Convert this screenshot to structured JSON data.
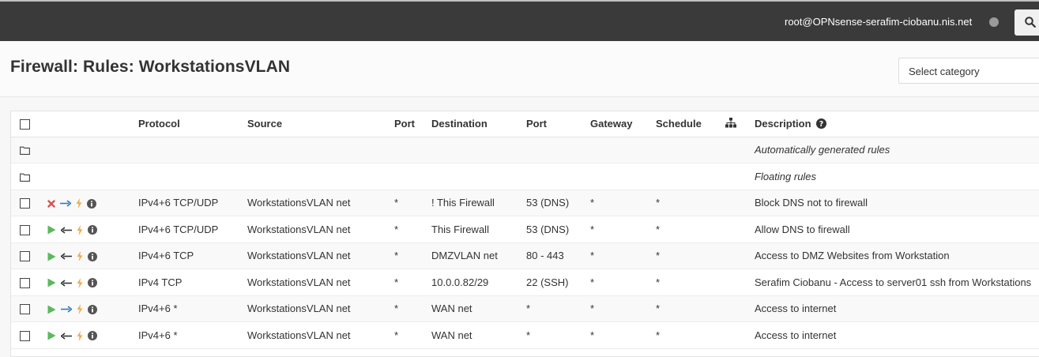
{
  "header": {
    "user": "root@OPNsense-serafim-ciobanu.nis.net"
  },
  "page": {
    "title": "Firewall: Rules: WorkstationsVLAN",
    "category_select": "Select category"
  },
  "table": {
    "columns": [
      "Protocol",
      "Source",
      "Port",
      "Destination",
      "Port",
      "Gateway",
      "Schedule",
      "Description"
    ],
    "group_rows": [
      {
        "label": "Automatically generated rules"
      },
      {
        "label": "Floating rules"
      }
    ],
    "rows": [
      {
        "action": "block",
        "direction": "in",
        "protocol": "IPv4+6 TCP/UDP",
        "source": "WorkstationsVLAN net",
        "source_port": "*",
        "destination": "! This Firewall",
        "dest_port": "53 (DNS)",
        "gateway": "*",
        "schedule": "*",
        "description": "Block DNS not to firewall"
      },
      {
        "action": "pass",
        "direction": "out",
        "protocol": "IPv4+6 TCP/UDP",
        "source": "WorkstationsVLAN net",
        "source_port": "*",
        "destination": "This Firewall",
        "dest_port": "53 (DNS)",
        "gateway": "*",
        "schedule": "*",
        "description": "Allow DNS to firewall"
      },
      {
        "action": "pass",
        "direction": "out",
        "protocol": "IPv4+6 TCP",
        "source": "WorkstationsVLAN net",
        "source_port": "*",
        "destination": "DMZVLAN net",
        "dest_port": "80 - 443",
        "gateway": "*",
        "schedule": "*",
        "description": "Access to DMZ Websites from Workstation"
      },
      {
        "action": "pass",
        "direction": "out",
        "protocol": "IPv4 TCP",
        "source": "WorkstationsVLAN net",
        "source_port": "*",
        "destination": "10.0.0.82/29",
        "dest_port": "22 (SSH)",
        "gateway": "*",
        "schedule": "*",
        "description": "Serafim Ciobanu - Access to server01 ssh from Workstations"
      },
      {
        "action": "pass",
        "direction": "in",
        "protocol": "IPv4+6 *",
        "source": "WorkstationsVLAN net",
        "source_port": "*",
        "destination": "WAN net",
        "dest_port": "*",
        "gateway": "*",
        "schedule": "*",
        "description": "Access to internet"
      },
      {
        "action": "pass",
        "direction": "out",
        "protocol": "IPv4+6 *",
        "source": "WorkstationsVLAN net",
        "source_port": "*",
        "destination": "WAN net",
        "dest_port": "*",
        "gateway": "*",
        "schedule": "*",
        "description": "Access to internet"
      }
    ]
  },
  "colors": {
    "topbar": "#3a3a3a",
    "block": "#d9534f",
    "pass": "#5cb85c",
    "direction_in": "#337ab7",
    "direction_out": "#333333",
    "log": "#f0ad4e",
    "info": "#555555"
  },
  "icons": {
    "block": "block-x-icon",
    "pass": "pass-play-icon",
    "direction_in": "arrow-right-icon",
    "direction_out": "arrow-left-icon",
    "log": "bolt-icon",
    "info": "info-circle-icon",
    "group": "folder-icon",
    "gateway": "sitemap-icon",
    "help": "help-circle-icon",
    "search": "search-icon"
  }
}
